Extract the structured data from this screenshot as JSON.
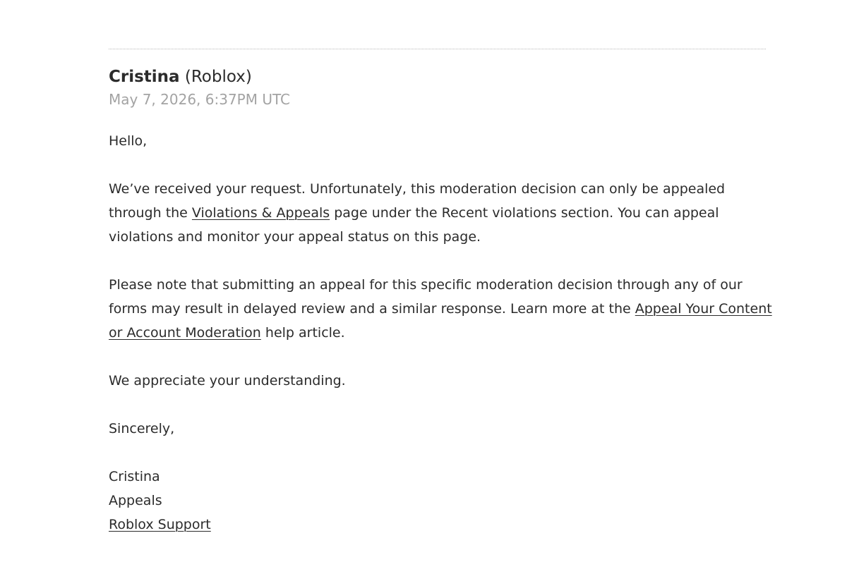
{
  "sender": {
    "name": "Cristina",
    "org": "(Roblox)"
  },
  "timestamp": "May 7, 2026, 6:37PM UTC",
  "body": {
    "greeting": "Hello,",
    "p1": {
      "l1": "We’ve received your request. Unfortunately, this moderation decision can only be appealed",
      "l2_pre": "through the ",
      "l2_link": "Violations & Appeals",
      "l2_post": " page under the Recent violations section. You can appeal",
      "l3": "violations and monitor your appeal status on this page."
    },
    "p2": {
      "l1": "Please note that submitting an appeal for this specific moderation decision through any of our",
      "l2_pre": "forms may result in delayed review and a similar response. Learn more at the ",
      "l2_link": "Appeal Your Content",
      "l3_link": "or Account Moderation",
      "l3_post": " help article."
    },
    "closing1": "We appreciate your understanding.",
    "closing2": "Sincerely,",
    "signature": {
      "name": "Cristina",
      "team": "Appeals",
      "link": "Roblox Support"
    }
  }
}
